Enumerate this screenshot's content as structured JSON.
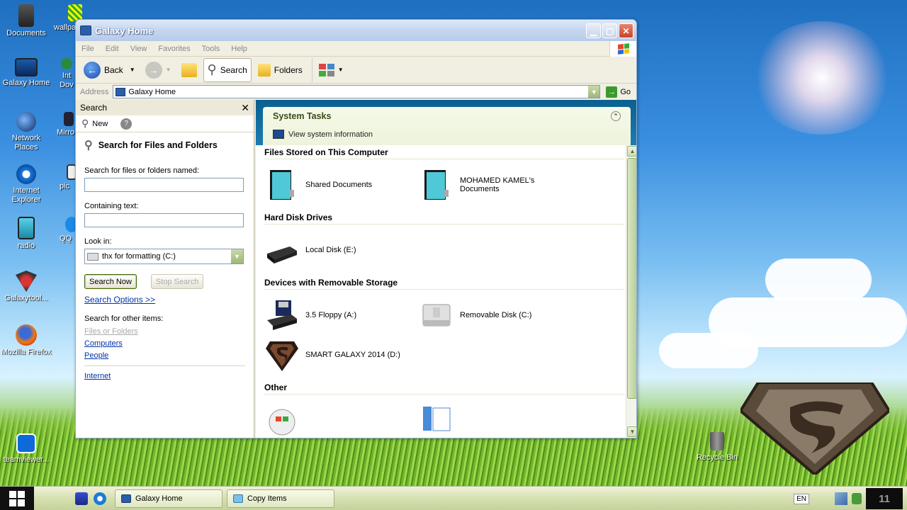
{
  "desktop": {
    "icons": [
      {
        "label": "Documents",
        "icon": "documents-icon"
      },
      {
        "label": "wallpa",
        "icon": "wallpaper-icon"
      },
      {
        "label": "Galaxy Home",
        "icon": "computer-icon"
      },
      {
        "label": "Int Dov",
        "icon": "internet-download-icon"
      },
      {
        "label": "Network Places",
        "icon": "network-globe-icon"
      },
      {
        "label": "Mirro",
        "icon": "mirror-icon"
      },
      {
        "label": "Internet Explorer",
        "icon": "ie-icon"
      },
      {
        "label": "pic",
        "icon": "pictures-icon"
      },
      {
        "label": "radio",
        "icon": "radio-icon"
      },
      {
        "label": "QQ",
        "icon": "qq-icon"
      },
      {
        "label": "Galaxytool...",
        "icon": "galaxytool-icon"
      },
      {
        "label": "Mozilla Firefox",
        "icon": "firefox-icon"
      },
      {
        "label": "teamviewer...",
        "icon": "teamviewer-icon"
      }
    ],
    "recycle_bin": "Recycle Bin"
  },
  "window": {
    "title": "Galaxy Home",
    "menu": [
      "File",
      "Edit",
      "View",
      "Favorites",
      "Tools",
      "Help"
    ],
    "toolbar": {
      "back": "Back",
      "search": "Search",
      "folders": "Folders"
    },
    "address": {
      "label": "Address",
      "value": "Galaxy Home",
      "go": "Go"
    }
  },
  "search_pane": {
    "title": "Search",
    "new": "New",
    "heading": "Search for Files and Folders",
    "named_label": "Search for files or folders named:",
    "named_value": "",
    "containing_label": "Containing text:",
    "containing_value": "",
    "look_in_label": "Look in:",
    "look_in_value": "thx for formatting (C:)",
    "search_now": "Search Now",
    "stop_search": "Stop Search",
    "options": "Search Options >>",
    "other_label": "Search for other items:",
    "other_items": [
      "Files or Folders",
      "Computers",
      "People"
    ],
    "internet": "Internet"
  },
  "system_tasks": {
    "title": "System Tasks",
    "items": [
      "View system information"
    ]
  },
  "groups": [
    {
      "title": "Files Stored on This Computer",
      "items": [
        {
          "label": "Shared Documents",
          "icon": "folder-teal-icon"
        },
        {
          "label": "MOHAMED KAMEL's Documents",
          "icon": "folder-teal-icon"
        }
      ]
    },
    {
      "title": "Hard Disk Drives",
      "items": [
        {
          "label": "Local Disk (E:)",
          "icon": "hard-disk-icon"
        }
      ]
    },
    {
      "title": "Devices with Removable Storage",
      "items": [
        {
          "label": "3.5 Floppy (A:)",
          "icon": "floppy-drive-icon"
        },
        {
          "label": "Removable Disk (C:)",
          "icon": "removable-disk-icon"
        },
        {
          "label": "SMART GALAXY 2014 (D:)",
          "icon": "superman-drive-icon"
        }
      ]
    },
    {
      "title": "Other",
      "items": [
        {
          "label": "",
          "icon": "control-panel-icon"
        },
        {
          "label": "",
          "icon": "folder-options-icon"
        }
      ]
    }
  ],
  "taskbar": {
    "tasks": [
      "Galaxy Home",
      "Copy Items"
    ],
    "lang": "EN",
    "clock": "11"
  }
}
